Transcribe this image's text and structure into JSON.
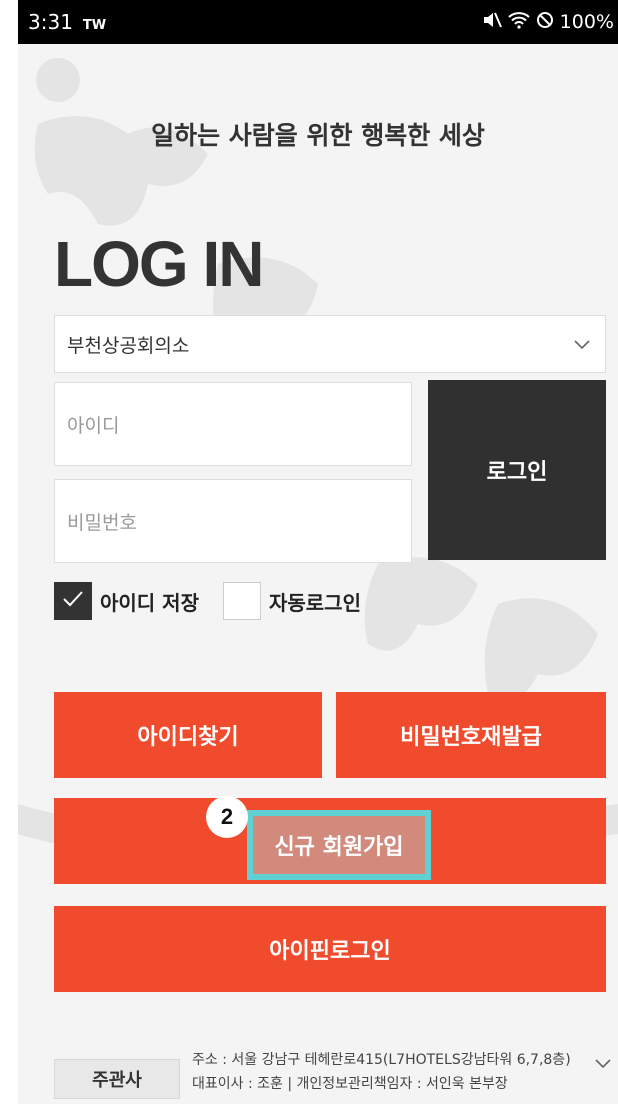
{
  "status_bar": {
    "time": "3:31",
    "carrier": "TW",
    "battery": "100%"
  },
  "page": {
    "tagline": "일하는 사람을 위한 행복한 세상",
    "title": "LOG IN"
  },
  "form": {
    "organization_selected": "부천상공회의소",
    "id_placeholder": "아이디",
    "password_placeholder": "비밀번호",
    "login_button": "로그인",
    "save_id_label": "아이디 저장",
    "save_id_checked": true,
    "auto_login_label": "자동로그인",
    "auto_login_checked": false
  },
  "actions": {
    "find_id": "아이디찾기",
    "reset_password": "비밀번호재발급",
    "signup": "신규 회원가입",
    "ipin_login": "아이핀로그인"
  },
  "annotation": {
    "step": "2"
  },
  "footer": {
    "label": "주관사",
    "address": "주소 : 서울 강남구 테헤란로415(L7HOTELS강남타워 6,7,8층)",
    "ceo_line": "대표이사 : 조훈  |  개인정보관리책임자 : 서인욱 본부장"
  },
  "colors": {
    "accent": "#f04b2d",
    "dark": "#303030",
    "highlight": "#5fd1d3"
  }
}
